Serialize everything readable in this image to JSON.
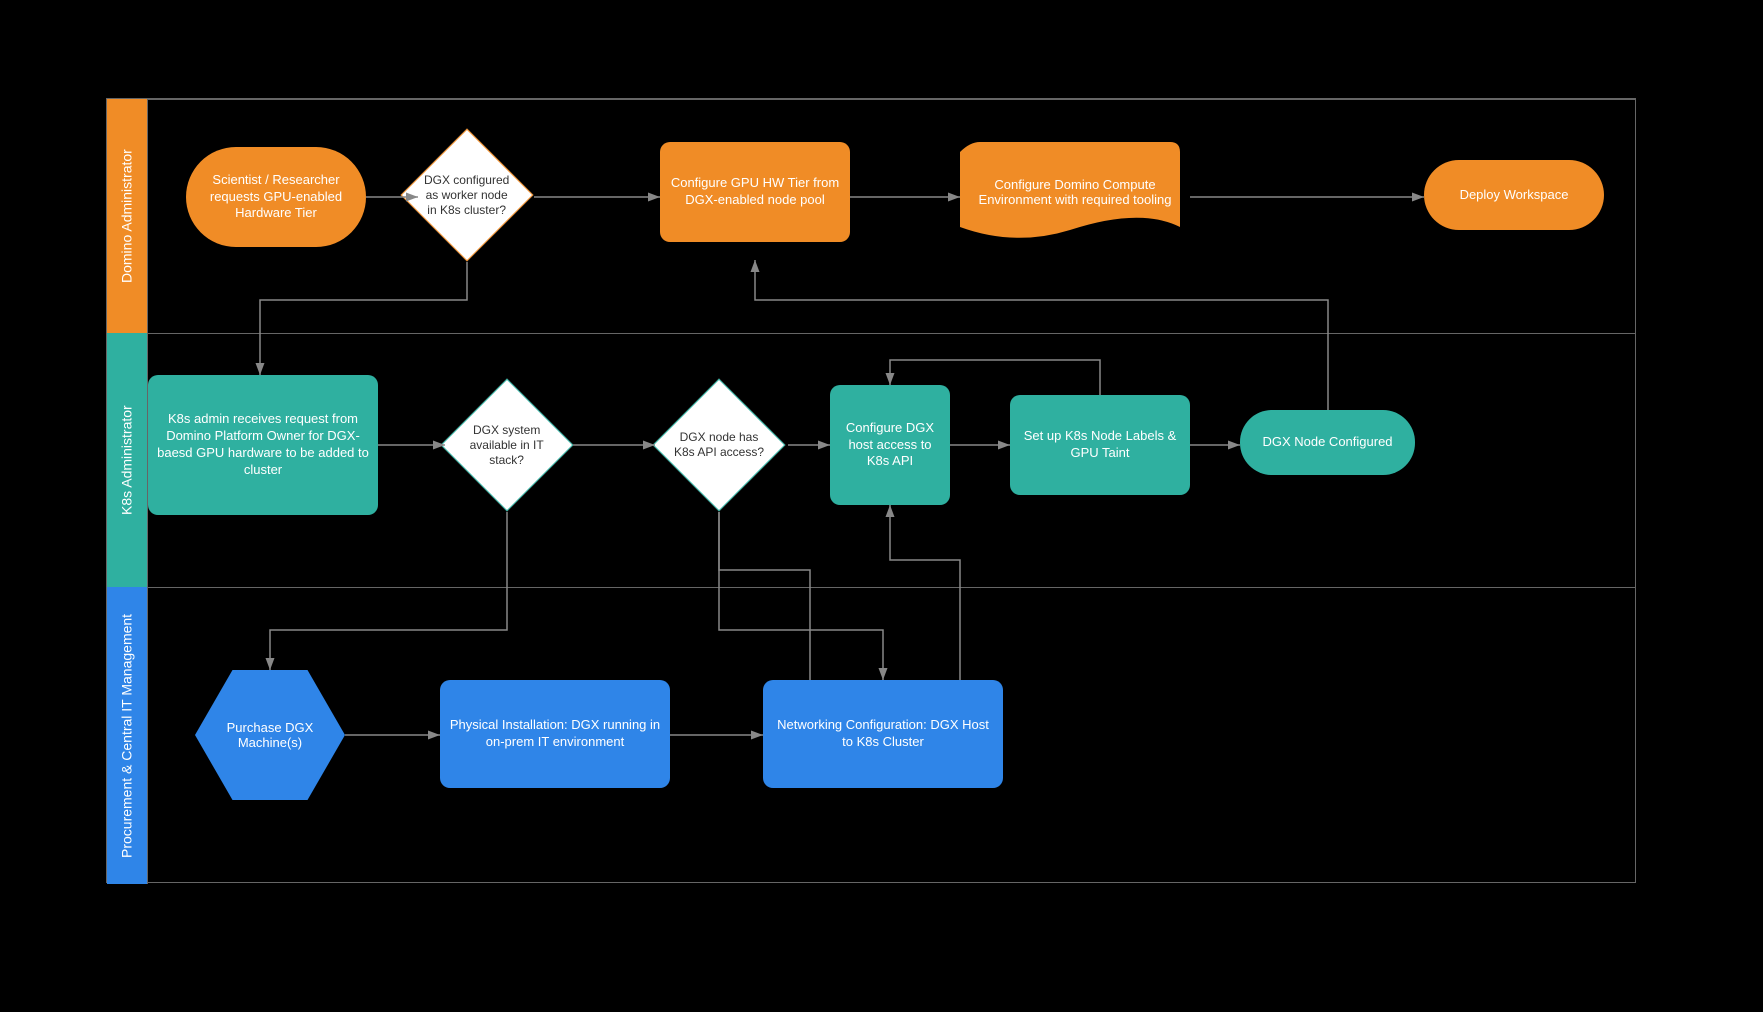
{
  "lanes": {
    "lane1": "Domino Administrator",
    "lane2": "K8s Administrator",
    "lane3": "Procurement & Central IT Management"
  },
  "nodes": {
    "start": "Scientist / Researcher requests GPU-enabled Hardware Tier",
    "d1": "DGX configured as worker node in K8s cluster?",
    "conf_gpu": "Configure GPU HW Tier from DGX-enabled node pool",
    "conf_domino": "Configure Domino Compute Environment with required tooling",
    "deploy": "Deploy Workspace",
    "k8s_req": "K8s admin receives request from Domino Platform Owner for DGX-baesd GPU hardware to be added to cluster",
    "d2": "DGX system available in IT stack?",
    "d3": "DGX node has K8s API access?",
    "conf_dgx": "Configure DGX host access to K8s API",
    "labels": "Set up K8s Node Labels & GPU Taint",
    "dgx_done": "DGX Node Configured",
    "purchase": "Purchase DGX Machine(s)",
    "install": "Physical Installation: DGX running in on-prem IT environment",
    "network": "Networking Configuration: DGX Host to K8s Cluster"
  },
  "colors": {
    "orange": "#f08c26",
    "teal": "#2fb0a0",
    "blue": "#2f85e8"
  }
}
